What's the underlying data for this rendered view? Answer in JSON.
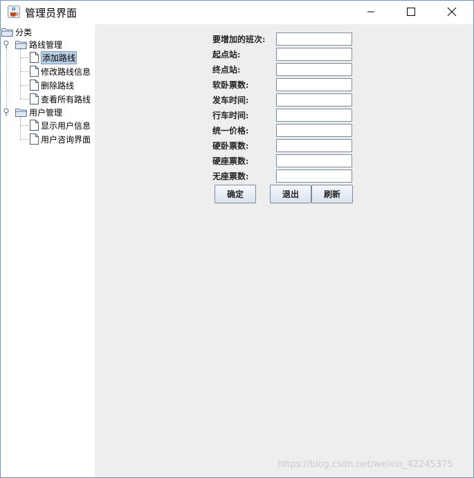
{
  "window": {
    "title": "管理员界面"
  },
  "tree": {
    "root": "分类",
    "groups": [
      {
        "label": "路线管理",
        "items": [
          "添加路线",
          "修改路线信息",
          "删除路线",
          "查看所有路线"
        ]
      },
      {
        "label": "用户管理",
        "items": [
          "显示用户信息",
          "用户咨询界面"
        ]
      }
    ],
    "selected": "添加路线"
  },
  "form": {
    "fields": [
      {
        "label": "要增加的班次:",
        "value": ""
      },
      {
        "label": "起点站:",
        "value": ""
      },
      {
        "label": "终点站:",
        "value": ""
      },
      {
        "label": "软卧票数:",
        "value": ""
      },
      {
        "label": "发车时间:",
        "value": ""
      },
      {
        "label": "行车时间:",
        "value": ""
      },
      {
        "label": "统一价格:",
        "value": ""
      },
      {
        "label": "硬卧票数:",
        "value": ""
      },
      {
        "label": "硬座票数:",
        "value": ""
      },
      {
        "label": "无座票数:",
        "value": ""
      }
    ],
    "buttons": {
      "confirm": "确定",
      "exit": "退出",
      "refresh": "刷新"
    }
  },
  "watermark": "https://blog.csdn.net/weixin_42245375",
  "colors": {
    "panel_bg": "#eeeeee",
    "selection": "#b8cfe5"
  }
}
